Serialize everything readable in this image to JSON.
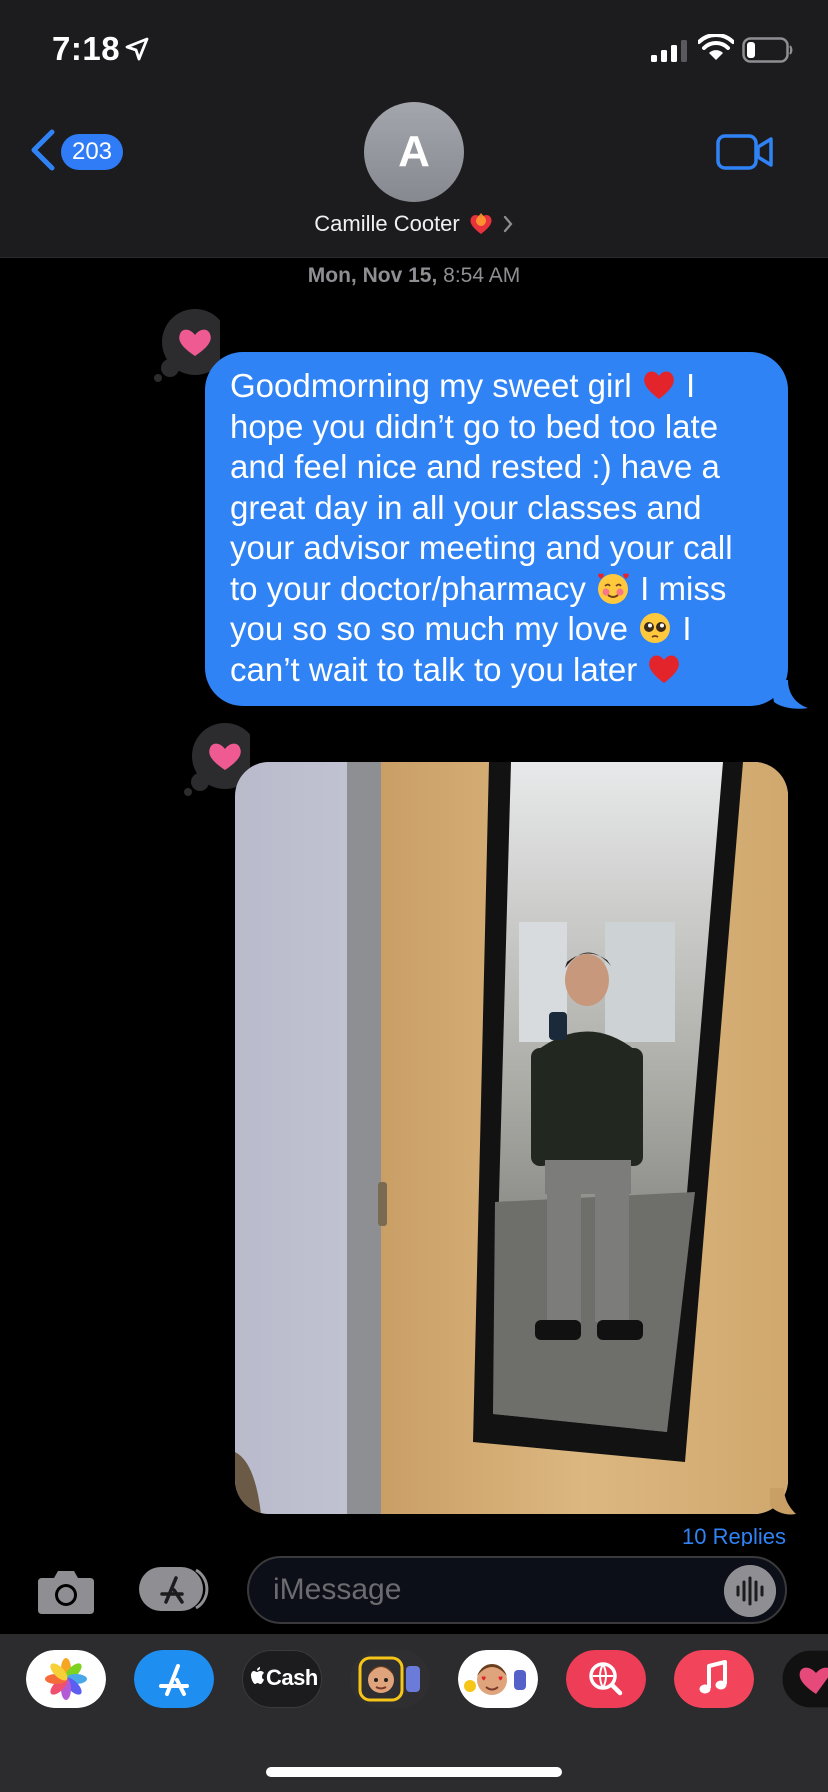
{
  "status_bar": {
    "time": "7:18"
  },
  "header": {
    "back_count": "203",
    "avatar_initial": "A",
    "contact_name": "Camille Cooter"
  },
  "conversation": {
    "timestamp_day": "Mon, Nov 15,",
    "timestamp_time": "8:54 AM",
    "messages": [
      {
        "type": "text",
        "tapback": "heart",
        "text_part_1": "Goodmorning my sweet girl ",
        "text_part_2": " I hope you didn’t go to bed too late and feel nice and rested :) have a great day in all your classes and your advisor meeting and your call to your doctor/pharmacy ",
        "text_part_3": " I miss you so so so much my love ",
        "text_part_4": " I can’t wait to talk to you later ",
        "emojis": [
          "red-heart",
          "smiling-face-with-hearts",
          "pleading-face",
          "red-heart"
        ]
      },
      {
        "type": "photo",
        "tapback": "heart"
      }
    ],
    "replies_label": "10 Replies"
  },
  "input_bar": {
    "placeholder": "iMessage"
  },
  "app_drawer": {
    "apps": [
      {
        "name": "Photos",
        "icon": "photos-icon"
      },
      {
        "name": "App Store",
        "icon": "app-store-icon"
      },
      {
        "name": "Apple Cash",
        "icon": "apple-cash-icon",
        "label": "Cash"
      },
      {
        "name": "Memoji",
        "icon": "memoji-icon"
      },
      {
        "name": "Memoji Stickers",
        "icon": "memoji-stickers-icon"
      },
      {
        "name": "Images Search",
        "icon": "images-search-icon"
      },
      {
        "name": "Music",
        "icon": "music-icon"
      },
      {
        "name": "Digital Touch",
        "icon": "digital-touch-icon"
      }
    ]
  },
  "colors": {
    "accent": "#2f83f5",
    "header_bg": "#1c1c1e",
    "tapback_heart": "#f05a92",
    "drawer_bg": "#2c2c2e"
  }
}
